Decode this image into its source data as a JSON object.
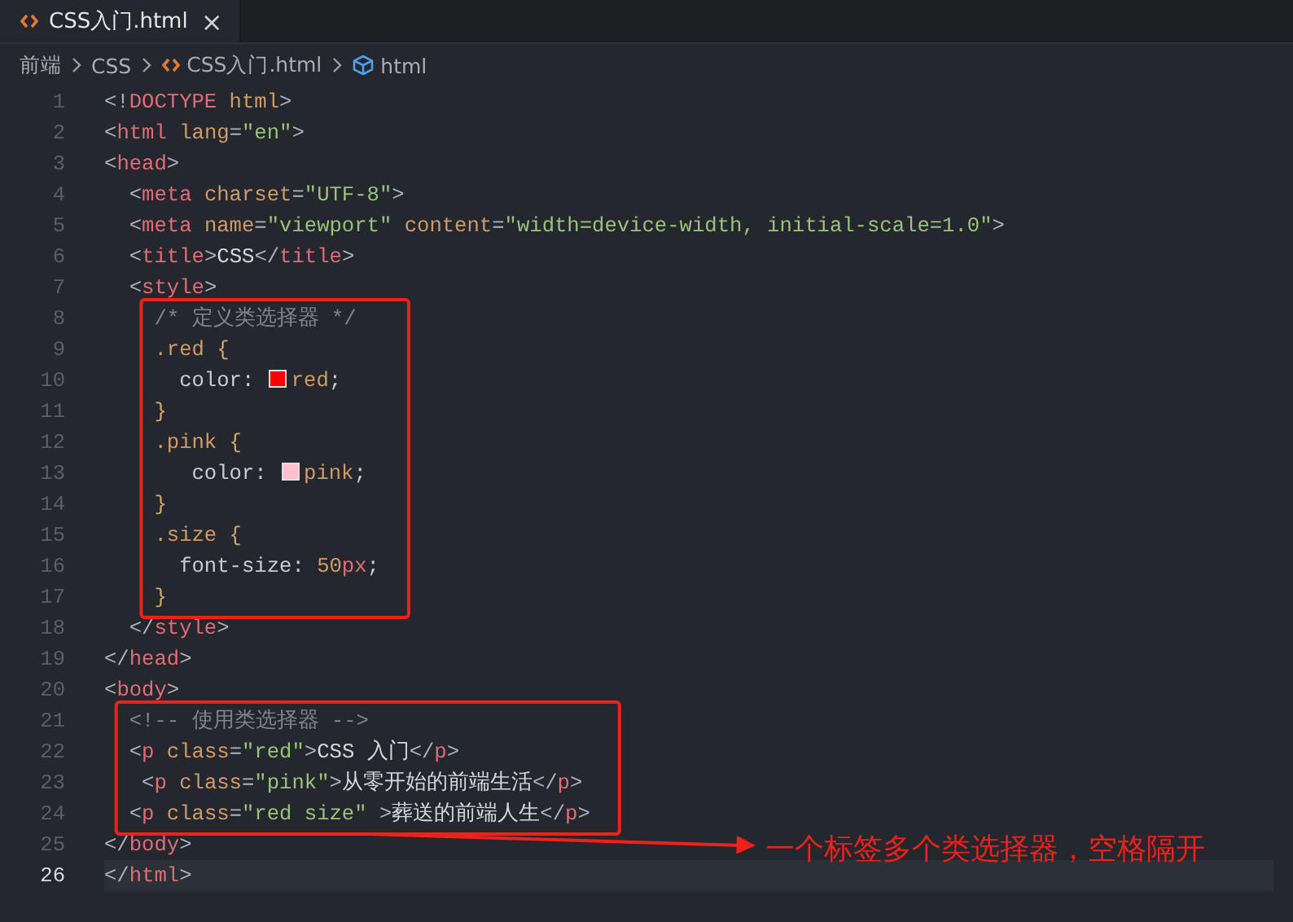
{
  "tabs": [
    {
      "label": "CSS入门.html",
      "selected": true,
      "close": "×"
    }
  ],
  "breadcrumbs": [
    {
      "label": "前端",
      "kind": "folder"
    },
    {
      "label": "CSS",
      "kind": "folder"
    },
    {
      "label": "CSS入门.html",
      "kind": "html-file"
    },
    {
      "label": "html",
      "kind": "element"
    }
  ],
  "code": [
    {
      "kind": "line",
      "number": "1",
      "current": false,
      "tokens": [
        {
          "kind": "punct",
          "text": "<!"
        },
        {
          "kind": "tag",
          "text": "DOCTYPE"
        },
        {
          "kind": "attr",
          "text": " html"
        },
        {
          "kind": "punct",
          "text": ">"
        }
      ]
    },
    {
      "kind": "line",
      "number": "2",
      "current": false,
      "tokens": [
        {
          "kind": "punct",
          "text": "<"
        },
        {
          "kind": "tag",
          "text": "html"
        },
        {
          "kind": "attr",
          "text": " lang"
        },
        {
          "kind": "punct",
          "text": "="
        },
        {
          "kind": "string",
          "text": "\"en\""
        },
        {
          "kind": "punct",
          "text": ">"
        }
      ]
    },
    {
      "kind": "line",
      "number": "3",
      "current": false,
      "tokens": [
        {
          "kind": "punct",
          "text": "<"
        },
        {
          "kind": "tag",
          "text": "head"
        },
        {
          "kind": "punct",
          "text": ">"
        }
      ]
    },
    {
      "kind": "line",
      "number": "4",
      "current": false,
      "tokens": [
        {
          "kind": "punct",
          "text": "  <"
        },
        {
          "kind": "tag",
          "text": "meta"
        },
        {
          "kind": "attr",
          "text": " charset"
        },
        {
          "kind": "punct",
          "text": "="
        },
        {
          "kind": "string",
          "text": "\"UTF-8\""
        },
        {
          "kind": "punct",
          "text": ">"
        }
      ]
    },
    {
      "kind": "line",
      "number": "5",
      "current": false,
      "tokens": [
        {
          "kind": "punct",
          "text": "  <"
        },
        {
          "kind": "tag",
          "text": "meta"
        },
        {
          "kind": "attr",
          "text": " name"
        },
        {
          "kind": "punct",
          "text": "="
        },
        {
          "kind": "string",
          "text": "\"viewport\""
        },
        {
          "kind": "attr",
          "text": " content"
        },
        {
          "kind": "punct",
          "text": "="
        },
        {
          "kind": "string",
          "text": "\"width=device-width, initial-scale=1.0\""
        },
        {
          "kind": "punct",
          "text": ">"
        }
      ]
    },
    {
      "kind": "line",
      "number": "6",
      "current": false,
      "tokens": [
        {
          "kind": "punct",
          "text": "  <"
        },
        {
          "kind": "tag",
          "text": "title"
        },
        {
          "kind": "punct",
          "text": ">"
        },
        {
          "kind": "text",
          "text": "CSS"
        },
        {
          "kind": "punct",
          "text": "</"
        },
        {
          "kind": "tag",
          "text": "title"
        },
        {
          "kind": "punct",
          "text": ">"
        }
      ]
    },
    {
      "kind": "line",
      "number": "7",
      "current": false,
      "tokens": [
        {
          "kind": "punct",
          "text": "  <"
        },
        {
          "kind": "tag",
          "text": "style"
        },
        {
          "kind": "punct",
          "text": ">"
        }
      ]
    },
    {
      "kind": "frame",
      "lines": [
        {
          "kind": "line",
          "number": "8",
          "current": false,
          "tokens": [
            {
              "kind": "comment",
              "text": "    /* 定义类选择器 */"
            }
          ]
        },
        {
          "kind": "line",
          "number": "9",
          "current": false,
          "tokens": [
            {
              "kind": "selector",
              "text": "    .red"
            },
            {
              "kind": "brace",
              "text": " {"
            }
          ]
        },
        {
          "kind": "line",
          "number": "10",
          "current": false,
          "tokens": [
            {
              "kind": "prop",
              "text": "      color: "
            },
            {
              "kind": "swatch",
              "color": "#ff0000"
            },
            {
              "kind": "value",
              "text": "red"
            },
            {
              "kind": "prop",
              "text": ";"
            }
          ]
        },
        {
          "kind": "line",
          "number": "11",
          "current": false,
          "tokens": [
            {
              "kind": "brace",
              "text": "    }"
            }
          ]
        },
        {
          "kind": "line",
          "number": "12",
          "current": false,
          "tokens": [
            {
              "kind": "selector",
              "text": "    .pink"
            },
            {
              "kind": "brace",
              "text": " {"
            }
          ]
        },
        {
          "kind": "line",
          "number": "13",
          "current": false,
          "tokens": [
            {
              "kind": "prop",
              "text": "       color: "
            },
            {
              "kind": "swatch",
              "color": "#ffc0cb"
            },
            {
              "kind": "value",
              "text": "pink"
            },
            {
              "kind": "prop",
              "text": ";"
            }
          ]
        },
        {
          "kind": "line",
          "number": "14",
          "current": false,
          "tokens": [
            {
              "kind": "brace",
              "text": "    }"
            }
          ]
        },
        {
          "kind": "line",
          "number": "15",
          "current": false,
          "tokens": [
            {
              "kind": "selector",
              "text": "    .size"
            },
            {
              "kind": "brace",
              "text": " {"
            }
          ]
        },
        {
          "kind": "line",
          "number": "16",
          "current": false,
          "tokens": [
            {
              "kind": "prop",
              "text": "      font-size: "
            },
            {
              "kind": "value",
              "text": "50"
            },
            {
              "kind": "tag",
              "text": "px"
            },
            {
              "kind": "prop",
              "text": ";"
            }
          ]
        },
        {
          "kind": "line",
          "number": "17",
          "current": false,
          "tokens": [
            {
              "kind": "brace",
              "text": "    }"
            }
          ]
        }
      ]
    },
    {
      "kind": "line",
      "number": "18",
      "current": false,
      "tokens": [
        {
          "kind": "punct",
          "text": "  </"
        },
        {
          "kind": "tag",
          "text": "style"
        },
        {
          "kind": "punct",
          "text": ">"
        }
      ]
    },
    {
      "kind": "line",
      "number": "19",
      "current": false,
      "tokens": [
        {
          "kind": "punct",
          "text": "</"
        },
        {
          "kind": "tag",
          "text": "head"
        },
        {
          "kind": "punct",
          "text": ">"
        }
      ]
    },
    {
      "kind": "line",
      "number": "20",
      "current": false,
      "tokens": [
        {
          "kind": "punct",
          "text": "<"
        },
        {
          "kind": "tag",
          "text": "body"
        },
        {
          "kind": "punct",
          "text": ">"
        }
      ]
    },
    {
      "kind": "frame",
      "lines": [
        {
          "kind": "line",
          "number": "21",
          "current": false,
          "tokens": [
            {
              "kind": "comment",
              "text": "  <!-- 使用类选择器 -->"
            }
          ]
        },
        {
          "kind": "line",
          "number": "22",
          "current": false,
          "tokens": [
            {
              "kind": "punct",
              "text": "  <"
            },
            {
              "kind": "tag",
              "text": "p"
            },
            {
              "kind": "attr",
              "text": " class"
            },
            {
              "kind": "punct",
              "text": "="
            },
            {
              "kind": "string",
              "text": "\"red\""
            },
            {
              "kind": "punct",
              "text": ">"
            },
            {
              "kind": "text",
              "text": "CSS 入门"
            },
            {
              "kind": "punct",
              "text": "</"
            },
            {
              "kind": "tag",
              "text": "p"
            },
            {
              "kind": "punct",
              "text": ">"
            }
          ]
        },
        {
          "kind": "line",
          "number": "23",
          "current": false,
          "tokens": [
            {
              "kind": "punct",
              "text": "   <"
            },
            {
              "kind": "tag",
              "text": "p"
            },
            {
              "kind": "attr",
              "text": " class"
            },
            {
              "kind": "punct",
              "text": "="
            },
            {
              "kind": "string",
              "text": "\"pink\""
            },
            {
              "kind": "punct",
              "text": ">"
            },
            {
              "kind": "text",
              "text": "从零开始的前端生活"
            },
            {
              "kind": "punct",
              "text": "</"
            },
            {
              "kind": "tag",
              "text": "p"
            },
            {
              "kind": "punct",
              "text": ">"
            }
          ]
        },
        {
          "kind": "line",
          "number": "24",
          "current": false,
          "tokens": [
            {
              "kind": "punct",
              "text": "  <"
            },
            {
              "kind": "tag",
              "text": "p"
            },
            {
              "kind": "attr",
              "text": " class"
            },
            {
              "kind": "punct",
              "text": "="
            },
            {
              "kind": "string",
              "text": "\"red size\""
            },
            {
              "kind": "punct",
              "text": " >"
            },
            {
              "kind": "text",
              "text": "葬送的前端人生"
            },
            {
              "kind": "punct",
              "text": "</"
            },
            {
              "kind": "tag",
              "text": "p"
            },
            {
              "kind": "punct",
              "text": ">"
            }
          ]
        }
      ]
    },
    {
      "kind": "line",
      "number": "25",
      "current": false,
      "tokens": [
        {
          "kind": "punct",
          "text": "</"
        },
        {
          "kind": "tag",
          "text": "body"
        },
        {
          "kind": "punct",
          "text": ">"
        }
      ]
    },
    {
      "kind": "line",
      "number": "26",
      "current": true,
      "tokens": [
        {
          "kind": "punct",
          "text": "</"
        },
        {
          "kind": "tag",
          "text": "html"
        },
        {
          "kind": "punct",
          "text": ">"
        }
      ]
    }
  ],
  "annotation": {
    "note": "一个标签多个类选择器，空格隔开"
  }
}
